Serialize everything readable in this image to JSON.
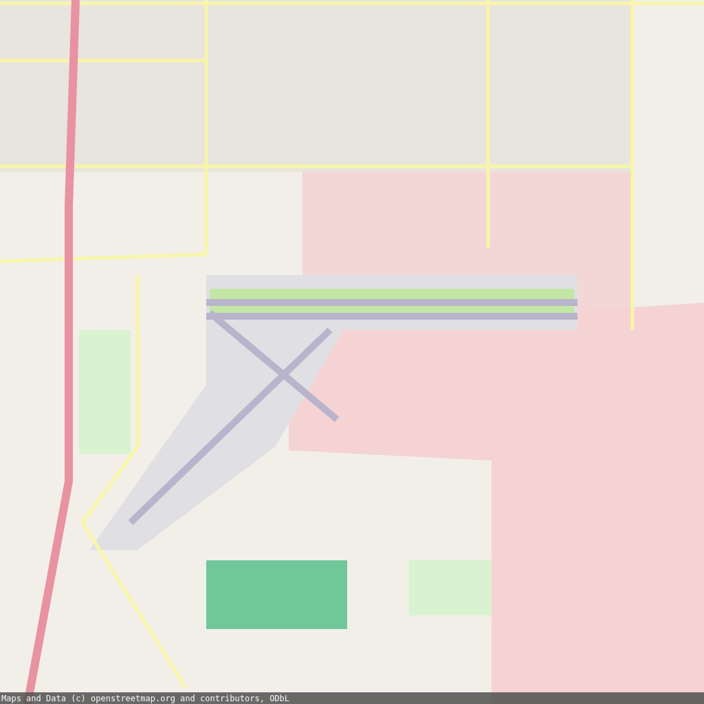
{
  "attribution": "Maps and Data (c) openstreetmap.org and contributors, ODbL"
}
